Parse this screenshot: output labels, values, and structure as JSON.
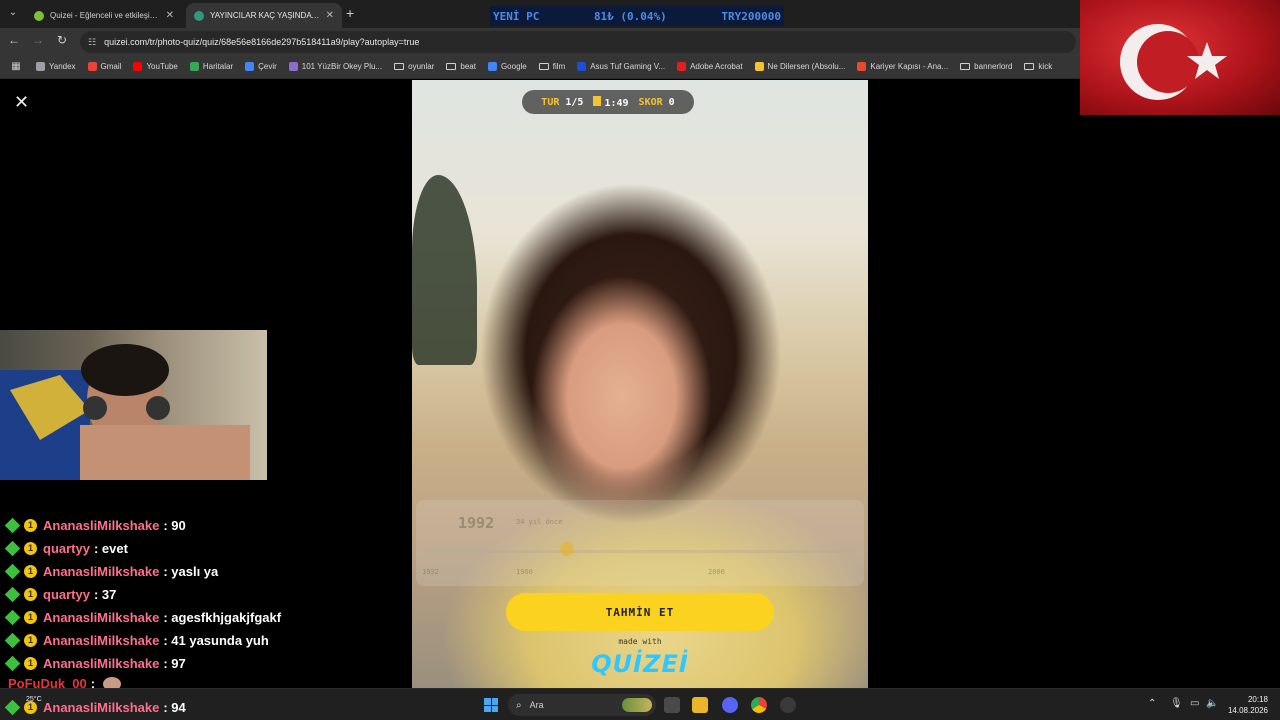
{
  "browser": {
    "tabs": [
      {
        "title": "Quizei - Eğlenceli ve etkileşimli",
        "active": false
      },
      {
        "title": "YAYINCILAR KAÇ YAŞINDA ? - Q",
        "active": true
      }
    ],
    "url": "quizei.com/tr/photo-quiz/quiz/68e56e8166de297b518411a9/play?autoplay=true",
    "bookmarks": [
      {
        "label": "Yandex",
        "color": "#9aa0a6"
      },
      {
        "label": "Gmail",
        "color": "#ea4335"
      },
      {
        "label": "YouTube",
        "color": "#ff0000"
      },
      {
        "label": "Haritalar",
        "color": "#34a853"
      },
      {
        "label": "Çevir",
        "color": "#4285f4"
      },
      {
        "label": "101 YüzBir Okey Plu...",
        "color": "#8e6cc9"
      },
      {
        "label": "oyunlar",
        "folder": true
      },
      {
        "label": "beat",
        "folder": true
      },
      {
        "label": "Google",
        "color": "#4285f4"
      },
      {
        "label": "film",
        "folder": true
      },
      {
        "label": "Asus Tuf Gaming V...",
        "color": "#1a4fd6"
      },
      {
        "label": "Adobe Acrobat",
        "color": "#e02020"
      },
      {
        "label": "Ne Dilersen (Absolu...",
        "color": "#f4c430"
      },
      {
        "label": "Kariyer Kapısı - Ana...",
        "color": "#e84a2f"
      },
      {
        "label": "bannerlord",
        "folder": true
      },
      {
        "label": "kick",
        "folder": true
      }
    ]
  },
  "ticker": {
    "left": "YENİ PC",
    "middle": "81₺ (0.04%)",
    "right": "TRY200000"
  },
  "quiz": {
    "round_label": "TUR",
    "round_value": "1/5",
    "time_value": "1:49",
    "score_label": "SKOR",
    "score_value": "0",
    "guess_year": "1992",
    "age_note": "34 yıl önce",
    "ticks": [
      "1932",
      "1960",
      "2000"
    ],
    "guess_button": "TAHMİN ET",
    "made_with": "made with",
    "brand": "QUİZEİ"
  },
  "chat": [
    {
      "user": "AnanasliMilkshake",
      "text": ": 90"
    },
    {
      "user": "quartyy",
      "text": ": evet"
    },
    {
      "user": "AnanasliMilkshake",
      "text": ": yaslı ya"
    },
    {
      "user": "quartyy",
      "text": ": 37"
    },
    {
      "user": "AnanasliMilkshake",
      "text": ": agesfkhjgakjfgakf"
    },
    {
      "user": "AnanasliMilkshake",
      "text": ": 41 yasunda yuh"
    },
    {
      "user": "AnanasliMilkshake",
      "text": ": 97"
    }
  ],
  "chat_partial": {
    "user": "PoFuDuk_00",
    "text": ":"
  },
  "chat_last": {
    "user": "AnanasliMilkshake",
    "text": ": 94"
  },
  "taskbar": {
    "search_placeholder": "Ara",
    "weather_temp": "25°C",
    "time": "20:18",
    "date": "14.08.2026"
  }
}
